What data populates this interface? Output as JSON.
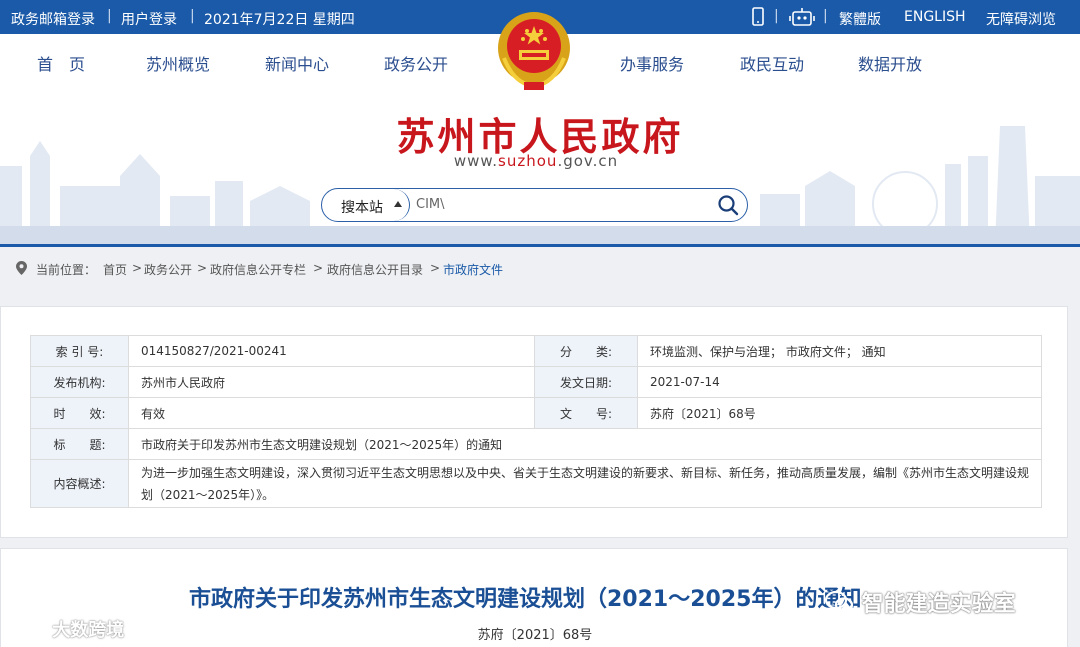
{
  "topbar": {
    "mail_login": "政务邮箱登录",
    "user_login": "用户登录",
    "date": "2021年7月22日 星期四",
    "traditional": "繁體版",
    "english": "ENGLISH",
    "accessible": "无障碍浏览",
    "icons": [
      "mobile-icon",
      "robot-icon"
    ]
  },
  "nav": {
    "items": [
      {
        "label": "首　页"
      },
      {
        "label": "苏州概览"
      },
      {
        "label": "新闻中心"
      },
      {
        "label": "政务公开"
      },
      {
        "label": "办事服务"
      },
      {
        "label": "政民互动"
      },
      {
        "label": "数据开放"
      }
    ]
  },
  "header": {
    "title": "苏州市人民政府",
    "url_prefix": "www.",
    "url_highlight": "suzhou",
    "url_suffix": ".gov.cn"
  },
  "search": {
    "scope": "搜本站",
    "value": "CIM\\"
  },
  "breadcrumb": {
    "label": "当前位置：",
    "items": [
      "首页",
      "政务公开",
      "政府信息公开专栏",
      "政府信息公开目录",
      "市政府文件"
    ],
    "separator": ">"
  },
  "meta": {
    "index_label": "索 引 号:",
    "index_value": "014150827/2021-00241",
    "category_label": "分　　类:",
    "category_value": "环境监测、保护与治理； 市政府文件； 通知",
    "publisher_label": "发布机构:",
    "publisher_value": "苏州市人民政府",
    "date_label": "发文日期:",
    "date_value": "2021-07-14",
    "validity_label": "时　　效:",
    "validity_value": "有效",
    "docno_label": "文　　号:",
    "docno_value": "苏府〔2021〕68号",
    "title_label": "标　　题:",
    "title_value": "市政府关于印发苏州市生态文明建设规划（2021～2025年）的通知",
    "summary_label": "内容概述:",
    "summary_value": "为进一步加强生态文明建设，深入贯彻习近平生态文明思想以及中央、省关于生态文明建设的新要求、新目标、新任务，推动高质量发展，编制《苏州市生态文明建设规划（2021～2025年）》。"
  },
  "article": {
    "title": "市政府关于印发苏州市生态文明建设规划（2021～2025年）的通知",
    "doc_number": "苏府〔2021〕68号"
  },
  "watermarks": {
    "left": "大数跨境",
    "right": "智能建造实验室"
  },
  "colors": {
    "primary_blue": "#1a5aa8",
    "title_red": "#c8161d",
    "nav_text": "#2b4e8f",
    "label_bg": "#eef3fa"
  }
}
